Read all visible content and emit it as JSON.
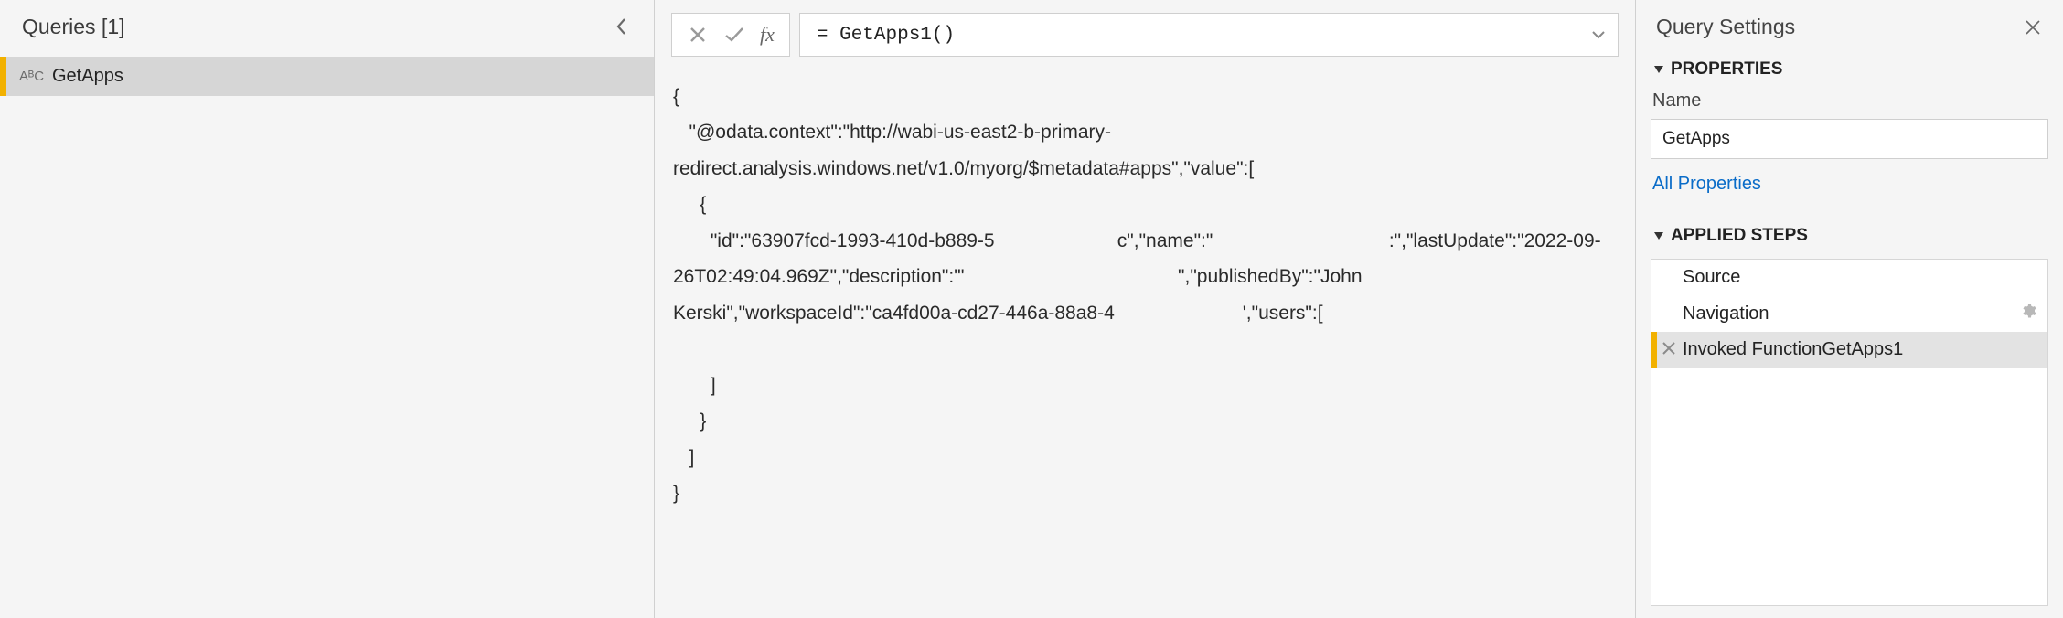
{
  "queries": {
    "header": "Queries [1]",
    "items": [
      {
        "type_icon": "AᴮC",
        "name": "GetApps"
      }
    ]
  },
  "formula": {
    "value": "= GetApps1()"
  },
  "result_text": "{\n   \"@odata.context\":\"http://wabi-us-east2-b-primary-redirect.analysis.windows.net/v1.0/myorg/$metadata#apps\",\"value\":[\n     {\n       \"id\":\"63907fcd-1993-410d-b889-5                       c\",\"name\":\"                                 :\",\"lastUpdate\":\"2022-09-26T02:49:04.969Z\",\"description\":\"'                                        \",\"publishedBy\":\"John Kerski\",\"workspaceId\":\"ca4fd00a-cd27-446a-88a8-4                        ',\"users\":[\n\n       ]\n     }\n   ]\n}",
  "settings": {
    "title": "Query Settings",
    "properties_label": "PROPERTIES",
    "name_label": "Name",
    "name_value": "GetApps",
    "all_properties": "All Properties",
    "applied_steps_label": "APPLIED STEPS",
    "steps": [
      {
        "label": "Source",
        "gear": false,
        "active": false
      },
      {
        "label": "Navigation",
        "gear": true,
        "active": false
      },
      {
        "label": "Invoked FunctionGetApps1",
        "gear": false,
        "active": true
      }
    ]
  }
}
